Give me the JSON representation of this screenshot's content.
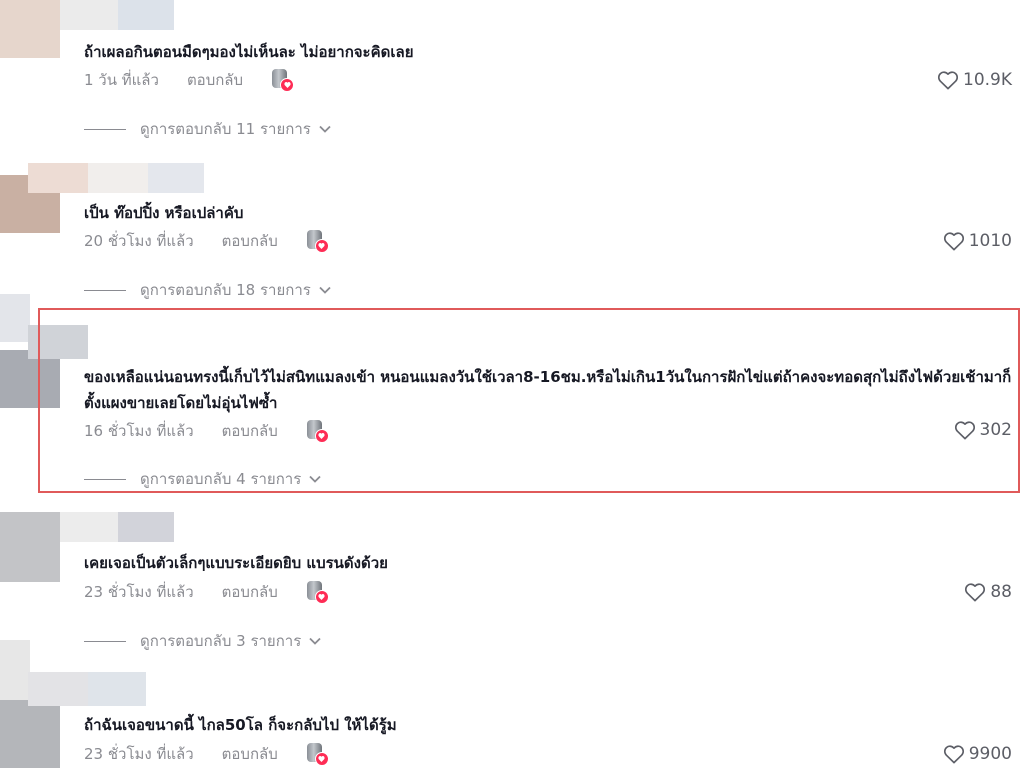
{
  "comments": [
    {
      "text": "ถ้าเผลอกินตอนมืดๆมองไม่เห็นละ ไม่อยากจะคิดเลย",
      "time": "1 วัน ที่แล้ว",
      "reply_label": "ตอบกลับ",
      "likes": "10.9K",
      "view_replies": "ดูการตอบกลับ 11 รายการ"
    },
    {
      "text": "เป็น ท๊อปปิ้ง หรือเปล่าคับ",
      "time": "20 ชั่วโมง ที่แล้ว",
      "reply_label": "ตอบกลับ",
      "likes": "1010",
      "view_replies": "ดูการตอบกลับ 18 รายการ"
    },
    {
      "text": "ของเหลือแน่นอนทรงนี้เก็บไว้ไม่สนิทแมลงเข้า หนอนแมลงวันใช้เวลา8-16ชม.หรือไม่เกิน1วันในการฝักไข่แต่ถ้าคงจะทอดสุกไม่ถึงไฟด้วยเช้ามาก็ตั้งแผงขายเลยโดยไม่อุ่นไฟซ้ำ",
      "time": "16 ชั่วโมง ที่แล้ว",
      "reply_label": "ตอบกลับ",
      "likes": "302",
      "view_replies": "ดูการตอบกลับ 4 รายการ"
    },
    {
      "text": "เคยเจอเป็นตัวเล็กๆแบบระเอียดยิบ แบรนดังด้วย",
      "time": "23 ชั่วโมง ที่แล้ว",
      "reply_label": "ตอบกลับ",
      "likes": "88",
      "view_replies": "ดูการตอบกลับ 3 รายการ"
    },
    {
      "text": "ถ้าฉันเจอขนาดนี้ ไกล50โล ก็จะกลับไป ให้ได้รู้ม",
      "time": "23 ชั่วโมง ที่แล้ว",
      "reply_label": "ตอบกลับ",
      "likes": "9900"
    }
  ],
  "icons": {
    "like": "heart-outline-icon",
    "chevron": "chevron-down-icon",
    "creator_liked": "creator-liked-avatar-icon"
  },
  "colors": {
    "text_primary": "#161823",
    "text_secondary": "#8a8b91",
    "like_badge": "#fe2c55",
    "highlight_border": "#e05a5a"
  }
}
